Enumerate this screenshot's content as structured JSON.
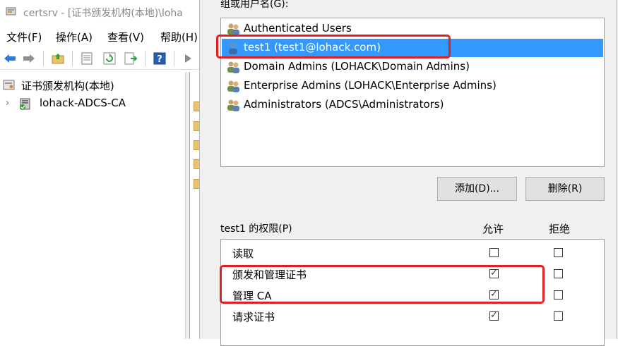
{
  "mmc": {
    "title": "certsrv - [证书颁发机构(本地)\\loha",
    "menu": [
      "文件(F)",
      "操作(A)",
      "查看(V)",
      "帮助(H)"
    ],
    "tree_root": "证书颁发机构(本地)",
    "tree_child": "lohack-ADCS-CA"
  },
  "dialog": {
    "group_label": "组或用户名(G):",
    "users": [
      {
        "name": "Authenticated Users",
        "icon": "group-icon"
      },
      {
        "name": "test1 (test1@lohack.com)",
        "icon": "user-icon",
        "selected": true
      },
      {
        "name": "Domain Admins (LOHACK\\Domain Admins)",
        "icon": "group-icon"
      },
      {
        "name": "Enterprise Admins (LOHACK\\Enterprise Admins)",
        "icon": "group-icon"
      },
      {
        "name": "Administrators (ADCS\\Administrators)",
        "icon": "group-icon"
      }
    ],
    "add_button": "添加(D)...",
    "remove_button": "删除(R)",
    "permissions_label": "test1 的权限(P)",
    "allow_header": "允许",
    "deny_header": "拒绝",
    "permissions": [
      {
        "name": "读取",
        "allow": false,
        "deny": false
      },
      {
        "name": "颁发和管理证书",
        "allow": true,
        "deny": false
      },
      {
        "name": "管理 CA",
        "allow": true,
        "deny": false
      },
      {
        "name": "请求证书",
        "allow": true,
        "deny": false
      }
    ]
  },
  "colors": {
    "selection": "#3399ff",
    "highlight": "#e02020",
    "dialog_bg": "#f0f0f0"
  }
}
